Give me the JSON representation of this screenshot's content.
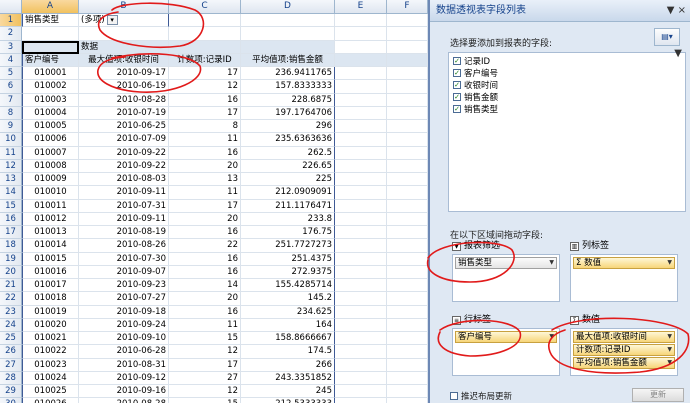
{
  "sheet": {
    "columns": [
      "A",
      "B",
      "C",
      "D",
      "E",
      "F"
    ],
    "page_filter": {
      "label": "销售类型",
      "value": "(多项)"
    },
    "row3_label": "数据",
    "headers": [
      "客户编号",
      "最大值项:收银时间",
      "计数项:记录ID",
      "平均值项:销售金额"
    ],
    "row_numbers": [
      "1",
      "2",
      "3",
      "4",
      "5",
      "6",
      "7",
      "8",
      "9",
      "10",
      "11",
      "12",
      "13",
      "14",
      "15",
      "16",
      "17",
      "18",
      "19",
      "20",
      "21",
      "22",
      "23",
      "24",
      "25",
      "26",
      "27",
      "28",
      "29",
      "30"
    ],
    "rows": [
      [
        "010001",
        "2010-09-17",
        "17",
        "236.9411765"
      ],
      [
        "010002",
        "2010-06-19",
        "12",
        "157.8333333"
      ],
      [
        "010003",
        "2010-08-28",
        "16",
        "228.6875"
      ],
      [
        "010004",
        "2010-07-19",
        "17",
        "197.1764706"
      ],
      [
        "010005",
        "2010-06-25",
        "8",
        "296"
      ],
      [
        "010006",
        "2010-07-09",
        "11",
        "235.6363636"
      ],
      [
        "010007",
        "2010-09-22",
        "16",
        "262.5"
      ],
      [
        "010008",
        "2010-09-22",
        "20",
        "226.65"
      ],
      [
        "010009",
        "2010-08-03",
        "13",
        "225"
      ],
      [
        "010010",
        "2010-09-11",
        "11",
        "212.0909091"
      ],
      [
        "010011",
        "2010-07-31",
        "17",
        "211.1176471"
      ],
      [
        "010012",
        "2010-09-11",
        "20",
        "233.8"
      ],
      [
        "010013",
        "2010-08-19",
        "16",
        "176.75"
      ],
      [
        "010014",
        "2010-08-26",
        "22",
        "251.7727273"
      ],
      [
        "010015",
        "2010-07-30",
        "16",
        "251.4375"
      ],
      [
        "010016",
        "2010-09-07",
        "16",
        "272.9375"
      ],
      [
        "010017",
        "2010-09-23",
        "14",
        "155.4285714"
      ],
      [
        "010018",
        "2010-07-27",
        "20",
        "145.2"
      ],
      [
        "010019",
        "2010-09-18",
        "16",
        "234.625"
      ],
      [
        "010020",
        "2010-09-24",
        "11",
        "164"
      ],
      [
        "010021",
        "2010-09-10",
        "15",
        "158.8666667"
      ],
      [
        "010022",
        "2010-06-28",
        "12",
        "174.5"
      ],
      [
        "010023",
        "2010-08-31",
        "17",
        "266"
      ],
      [
        "010024",
        "2010-09-12",
        "27",
        "243.3351852"
      ],
      [
        "010025",
        "2010-09-16",
        "12",
        "245"
      ],
      [
        "010026",
        "2010-08-28",
        "15",
        "212.5333333"
      ]
    ]
  },
  "panel": {
    "title": "数据透视表字段列表",
    "title_tools": "▼ ×",
    "chooser_label": "选择要添加到报表的字段:",
    "fields": [
      {
        "label": "记录ID",
        "checked": true
      },
      {
        "label": "客户编号",
        "checked": true
      },
      {
        "label": "收银时间",
        "checked": true
      },
      {
        "label": "销售金额",
        "checked": true
      },
      {
        "label": "销售类型",
        "checked": true
      }
    ],
    "drag_label": "在以下区域间拖动字段:",
    "areas": {
      "report_filter": {
        "title": "报表筛选",
        "items": [
          "销售类型"
        ]
      },
      "column_labels": {
        "title": "列标签",
        "items": [
          "Σ 数值"
        ]
      },
      "row_labels": {
        "title": "行标签",
        "items": [
          "客户编号"
        ]
      },
      "values": {
        "title": "数值",
        "items": [
          "最大值项:收银时间",
          "计数项:记录ID",
          "平均值项:销售金额"
        ]
      }
    },
    "defer_label": "推迟布局更新",
    "update_label": "更新"
  }
}
